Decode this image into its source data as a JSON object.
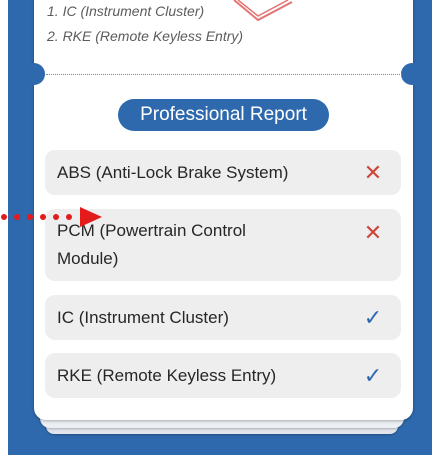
{
  "summary_list": [
    "1. IC (Instrument Cluster)",
    "2. RKE (Remote Keyless Entry)"
  ],
  "report": {
    "title": "Professional Report",
    "items": [
      {
        "label_lines": [
          "ABS (Anti-Lock Brake System)"
        ],
        "status": "fail",
        "icon": "cross-icon"
      },
      {
        "label_lines": [
          "PCM (Powertrain Control",
          "Module)"
        ],
        "status": "fail",
        "icon": "cross-icon"
      },
      {
        "label_lines": [
          "IC (Instrument Cluster)"
        ],
        "status": "pass",
        "icon": "check-icon"
      },
      {
        "label_lines": [
          "RKE (Remote Keyless Entry)"
        ],
        "status": "pass",
        "icon": "check-icon"
      }
    ]
  },
  "colors": {
    "brand_blue": "#2f69ad",
    "fail_red": "#d0453a",
    "pass_blue": "#2f69ad",
    "pointer_red": "#e31b1b"
  }
}
